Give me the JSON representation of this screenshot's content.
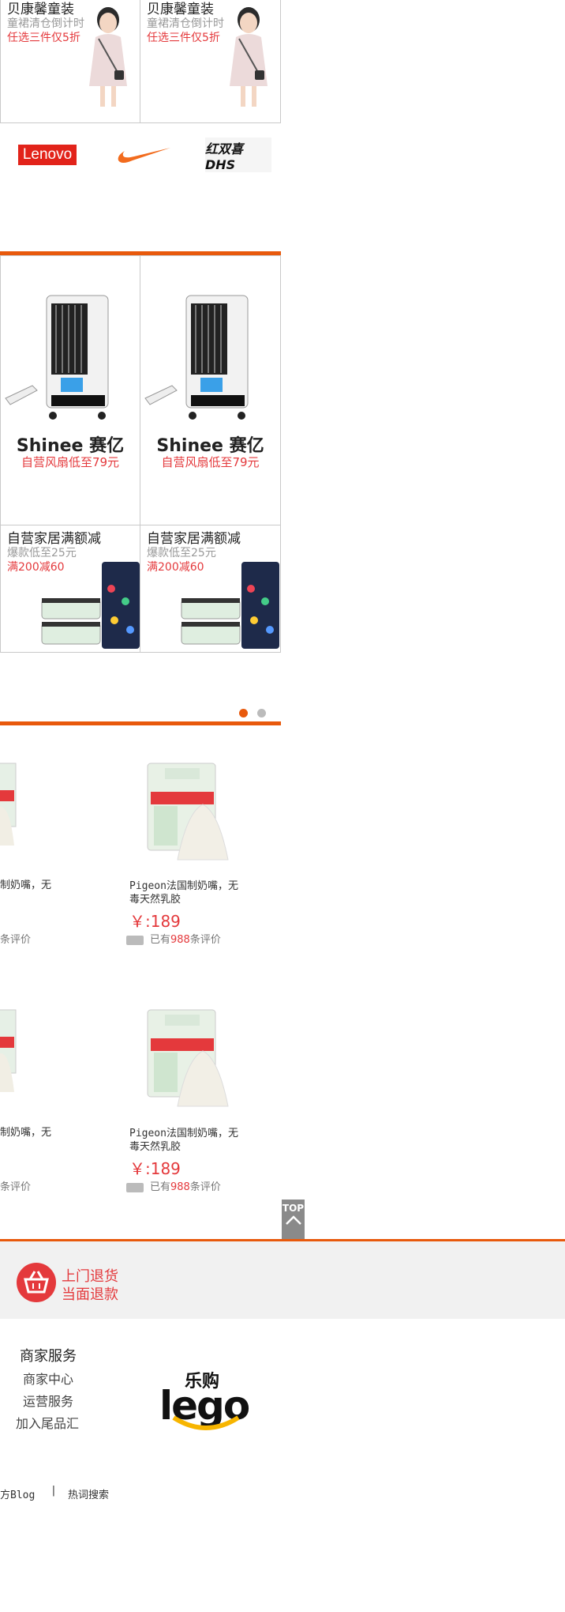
{
  "promo_top": [
    {
      "title": "贝康馨童装",
      "subtitle": "童裙清仓倒计时",
      "highlight": "任选三件仅5折"
    },
    {
      "title": "贝康馨童装",
      "subtitle": "童裙清仓倒计时",
      "highlight": "任选三件仅5折"
    }
  ],
  "brands": [
    "Lenovo",
    "Nike",
    "红双喜 DHS"
  ],
  "cooler_ads": [
    {
      "brand": "Shinee 赛亿",
      "caption": "自营风扇低至79元"
    },
    {
      "brand": "Shinee 赛亿",
      "caption": "自营风扇低至79元"
    }
  ],
  "home_ads": [
    {
      "title": "自营家居满额减",
      "subtitle": "爆款低至25元",
      "highlight": "满200减60"
    },
    {
      "title": "自营家居满额减",
      "subtitle": "爆款低至25元",
      "highlight": "满200减60"
    }
  ],
  "carousel": {
    "active_index": 0,
    "count": 2
  },
  "products": [
    {
      "name_partial": "制奶嘴，无",
      "reviews_partial": "条评价"
    },
    {
      "name": "Pigeon法国制奶嘴，无毒天然乳胶",
      "price": "￥:189",
      "reviews_prefix": "已有",
      "reviews_count": "988",
      "reviews_suffix": "条评价"
    },
    {
      "name_partial": "制奶嘴，无",
      "reviews_partial": "条评价"
    },
    {
      "name": "Pigeon法国制奶嘴，无毒天然乳胶",
      "price": "￥:189",
      "reviews_prefix": "已有",
      "reviews_count": "988",
      "reviews_suffix": "条评价"
    }
  ],
  "back_to_top": {
    "label": "TOP"
  },
  "return_service": {
    "line1": "上门退货",
    "line2": "当面退款"
  },
  "merchant": {
    "heading": "商家服务",
    "items": [
      "商家中心",
      "运营服务",
      "加入尾品汇"
    ]
  },
  "lego_logo": {
    "top": "乐购",
    "word": "lego"
  },
  "footer_links": [
    "方Blog",
    "|",
    "热词搜索"
  ],
  "colors": {
    "accent": "#e8590c",
    "price_red": "#e4393c",
    "lego_yellow": "#f7b500"
  }
}
